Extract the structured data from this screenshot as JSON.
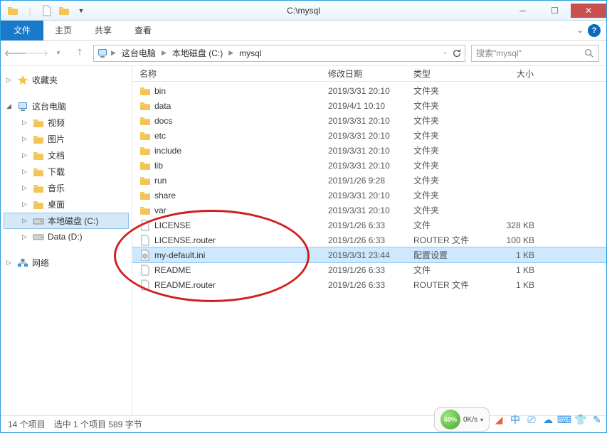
{
  "title": "C:\\mysql",
  "ribbon": {
    "file": "文件",
    "home": "主页",
    "share": "共享",
    "view": "查看"
  },
  "breadcrumbs": {
    "pc": "这台电脑",
    "drive": "本地磁盘 (C:)",
    "folder": "mysql"
  },
  "search_placeholder": "搜索\"mysql\"",
  "nav": {
    "favorites": "收藏夹",
    "thispc": "这台电脑",
    "videos": "视频",
    "pictures": "图片",
    "documents": "文档",
    "downloads": "下载",
    "music": "音乐",
    "desktop": "桌面",
    "local_c": "本地磁盘 (C:)",
    "data_d": "Data (D:)",
    "network": "网络"
  },
  "columns": {
    "name": "名称",
    "date": "修改日期",
    "type": "类型",
    "size": "大小"
  },
  "type_labels": {
    "folder": "文件夹",
    "file": "文件",
    "router": "ROUTER 文件",
    "config": "配置设置"
  },
  "files": [
    {
      "name": "bin",
      "date": "2019/3/31 20:10",
      "type": "文件夹",
      "size": "",
      "icon": "folder"
    },
    {
      "name": "data",
      "date": "2019/4/1 10:10",
      "type": "文件夹",
      "size": "",
      "icon": "folder"
    },
    {
      "name": "docs",
      "date": "2019/3/31 20:10",
      "type": "文件夹",
      "size": "",
      "icon": "folder"
    },
    {
      "name": "etc",
      "date": "2019/3/31 20:10",
      "type": "文件夹",
      "size": "",
      "icon": "folder"
    },
    {
      "name": "include",
      "date": "2019/3/31 20:10",
      "type": "文件夹",
      "size": "",
      "icon": "folder"
    },
    {
      "name": "lib",
      "date": "2019/3/31 20:10",
      "type": "文件夹",
      "size": "",
      "icon": "folder"
    },
    {
      "name": "run",
      "date": "2019/1/26 9:28",
      "type": "文件夹",
      "size": "",
      "icon": "folder"
    },
    {
      "name": "share",
      "date": "2019/3/31 20:10",
      "type": "文件夹",
      "size": "",
      "icon": "folder"
    },
    {
      "name": "var",
      "date": "2019/3/31 20:10",
      "type": "文件夹",
      "size": "",
      "icon": "folder"
    },
    {
      "name": "LICENSE",
      "date": "2019/1/26 6:33",
      "type": "文件",
      "size": "328 KB",
      "icon": "file"
    },
    {
      "name": "LICENSE.router",
      "date": "2019/1/26 6:33",
      "type": "ROUTER 文件",
      "size": "100 KB",
      "icon": "file"
    },
    {
      "name": "my-default.ini",
      "date": "2019/3/31 23:44",
      "type": "配置设置",
      "size": "1 KB",
      "icon": "ini",
      "selected": true
    },
    {
      "name": "README",
      "date": "2019/1/26 6:33",
      "type": "文件",
      "size": "1 KB",
      "icon": "file"
    },
    {
      "name": "README.router",
      "date": "2019/1/26 6:33",
      "type": "ROUTER 文件",
      "size": "1 KB",
      "icon": "file"
    }
  ],
  "status": {
    "items": "14 个项目",
    "selected": "选中 1 个项目  589 字节"
  },
  "tray": {
    "percent": "60%",
    "speed": "0K/s"
  }
}
